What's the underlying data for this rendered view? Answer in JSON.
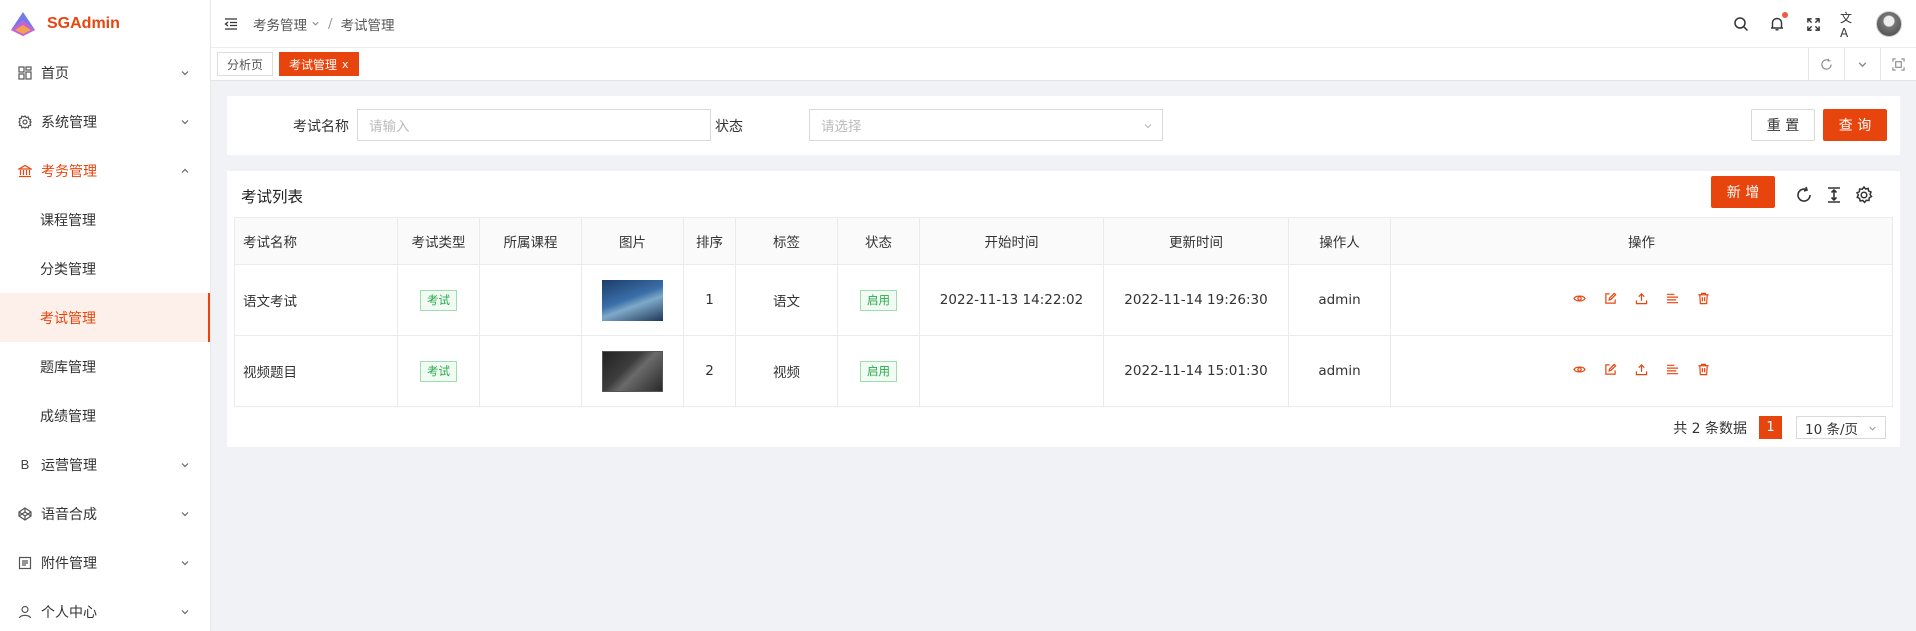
{
  "app": {
    "name": "SGAdmin",
    "brand_color": "#e8450e"
  },
  "sidebar": {
    "items": [
      {
        "label": "首页",
        "icon": "dashboard-icon"
      },
      {
        "label": "系统管理",
        "icon": "gear-icon"
      },
      {
        "label": "考务管理",
        "icon": "bank-icon",
        "open": true,
        "children": [
          {
            "label": "课程管理"
          },
          {
            "label": "分类管理"
          },
          {
            "label": "考试管理",
            "active": true
          },
          {
            "label": "题库管理"
          },
          {
            "label": "成绩管理"
          }
        ]
      },
      {
        "label": "运营管理",
        "icon": "b-letter-icon"
      },
      {
        "label": "语音合成",
        "icon": "codepen-icon"
      },
      {
        "label": "附件管理",
        "icon": "document-icon"
      },
      {
        "label": "个人中心",
        "icon": "user-icon"
      }
    ]
  },
  "header": {
    "breadcrumb": [
      "考务管理",
      "考试管理"
    ]
  },
  "tabs": [
    {
      "label": "分析页",
      "active": false
    },
    {
      "label": "考试管理",
      "active": true,
      "close": "x"
    }
  ],
  "filter": {
    "name_label": "考试名称",
    "name_placeholder": "请输入",
    "status_label": "状态",
    "status_placeholder": "请选择",
    "reset_label": "重 置",
    "search_label": "查 询"
  },
  "table_card": {
    "title": "考试列表",
    "add_label": "新 增",
    "columns": [
      "考试名称",
      "考试类型",
      "所属课程",
      "图片",
      "排序",
      "标签",
      "状态",
      "开始时间",
      "更新时间",
      "操作人",
      "操作"
    ],
    "rows": [
      {
        "name": "语文考试",
        "type": "考试",
        "course": "",
        "sort": "1",
        "tag": "语文",
        "status": "启用",
        "start": "2022-11-13 14:22:02",
        "updated": "2022-11-14 19:26:30",
        "operator": "admin"
      },
      {
        "name": "视频题目",
        "type": "考试",
        "course": "",
        "sort": "2",
        "tag": "视频",
        "status": "启用",
        "start": "",
        "updated": "2022-11-14 15:01:30",
        "operator": "admin"
      }
    ]
  },
  "pagination": {
    "total_text": "共 2 条数据",
    "current_page": "1",
    "page_size": "10 条/页"
  }
}
